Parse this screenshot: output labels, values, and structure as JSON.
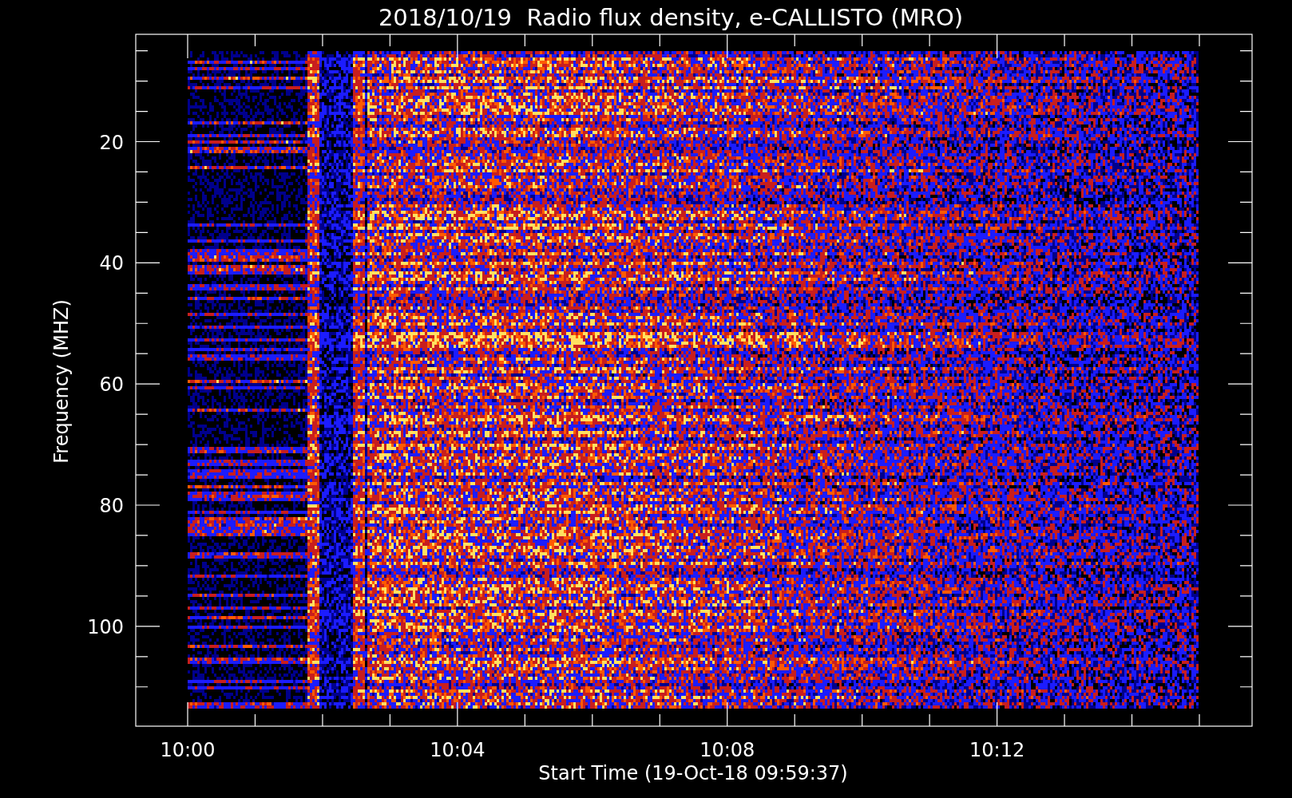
{
  "title": "2018/10/19  Radio flux density, e-CALLISTO (MRO)",
  "plot": {
    "ylabel": "Frequency (MHZ)",
    "xlabel": "Start Time (19-Oct-18 09:59:37)",
    "yticks": [
      "20",
      "40",
      "60",
      "80",
      "100"
    ],
    "xticks": [
      "10:00",
      "10:04",
      "10:08",
      "10:12"
    ]
  }
}
